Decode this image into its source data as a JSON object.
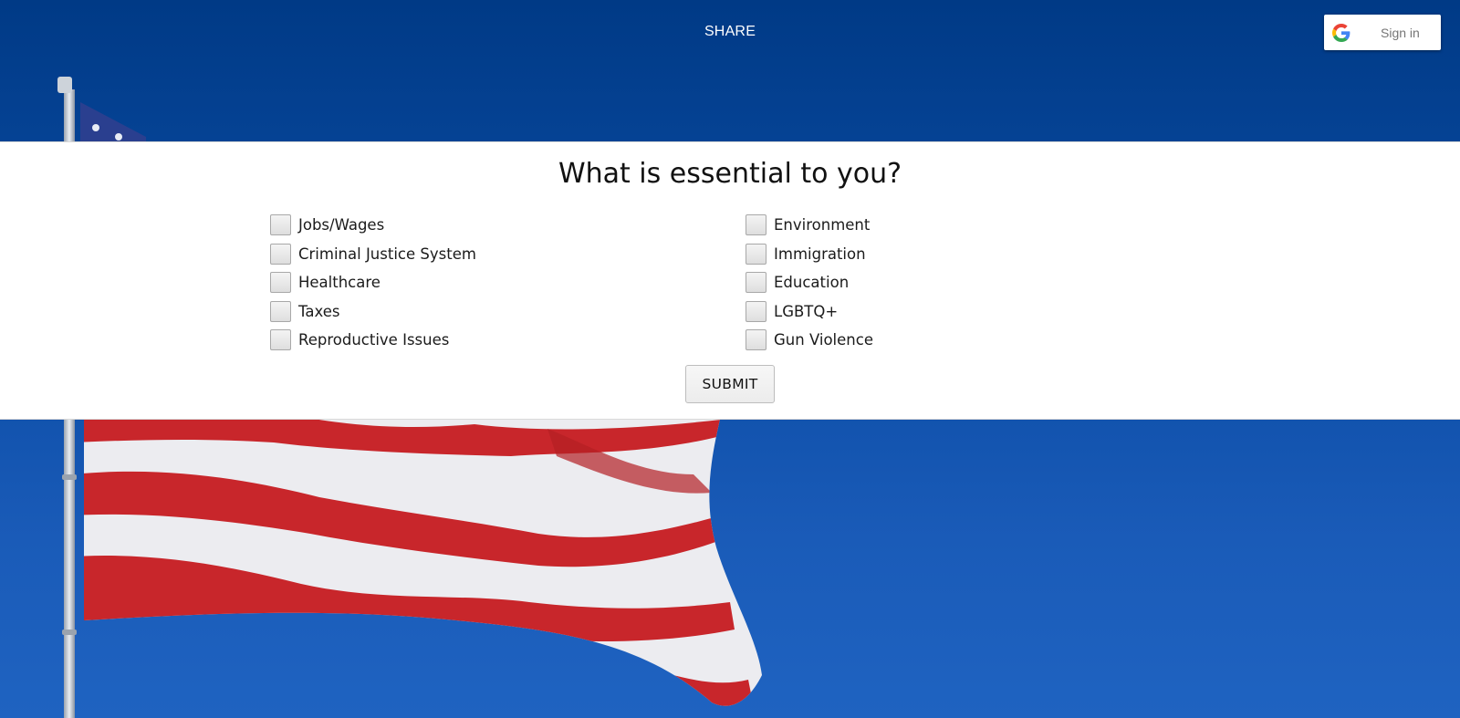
{
  "header": {
    "share_label": "SHARE",
    "signin_label": "Sign in",
    "signin_icon": "google-g-icon"
  },
  "survey": {
    "title": "What is essential to you?",
    "left_options": [
      {
        "label": "Jobs/Wages",
        "checked": false
      },
      {
        "label": "Criminal Justice System",
        "checked": false
      },
      {
        "label": "Healthcare",
        "checked": false
      },
      {
        "label": "Taxes",
        "checked": false
      },
      {
        "label": "Reproductive Issues",
        "checked": false
      }
    ],
    "right_options": [
      {
        "label": "Environment",
        "checked": false
      },
      {
        "label": "Immigration",
        "checked": false
      },
      {
        "label": "Education",
        "checked": false
      },
      {
        "label": "LGBTQ+",
        "checked": false
      },
      {
        "label": "Gun Violence",
        "checked": false
      }
    ],
    "submit_label": "SUBMIT"
  },
  "background": {
    "image": "american-flag-on-pole",
    "sky_color": "#0c4da6",
    "stripe_red": "#c8262b",
    "stripe_white": "#ececf0"
  }
}
